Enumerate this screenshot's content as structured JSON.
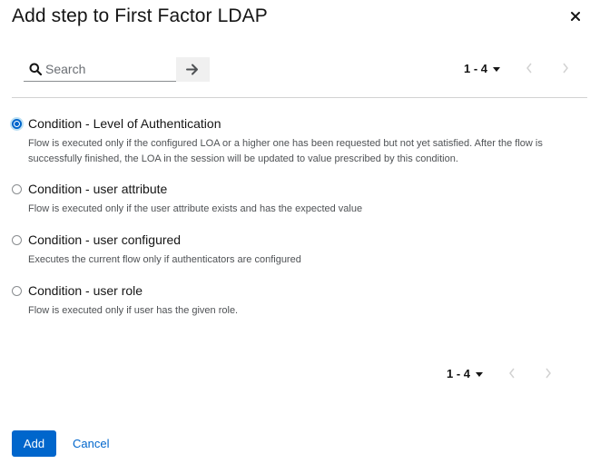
{
  "dialog": {
    "title": "Add step to First Factor LDAP",
    "close_icon": "close-icon"
  },
  "toolbar": {
    "search_placeholder": "Search",
    "search_value": "",
    "search_icon": "search-icon",
    "submit_icon": "arrow-right-icon"
  },
  "pagination_top": {
    "range": "1 - 4",
    "caret_icon": "caret-down-icon",
    "prev_icon": "angle-left-icon",
    "next_icon": "angle-right-icon",
    "prev_disabled": true,
    "next_disabled": true
  },
  "options": [
    {
      "label": "Condition - Level of Authentication",
      "description": "Flow is executed only if the configured LOA or a higher one has been requested but not yet satisfied. After the flow is successfully finished, the LOA in the session will be updated to value prescribed by this condition.",
      "selected": true
    },
    {
      "label": "Condition - user attribute",
      "description": "Flow is executed only if the user attribute exists and has the expected value",
      "selected": false
    },
    {
      "label": "Condition - user configured",
      "description": "Executes the current flow only if authenticators are configured",
      "selected": false
    },
    {
      "label": "Condition - user role",
      "description": "Flow is executed only if user has the given role.",
      "selected": false
    }
  ],
  "pagination_bottom": {
    "range": "1 - 4"
  },
  "footer": {
    "add_label": "Add",
    "cancel_label": "Cancel"
  },
  "colors": {
    "primary": "#0066cc",
    "text": "#151515",
    "muted": "#4f5255",
    "disabled_icon": "#d2d2d2"
  }
}
